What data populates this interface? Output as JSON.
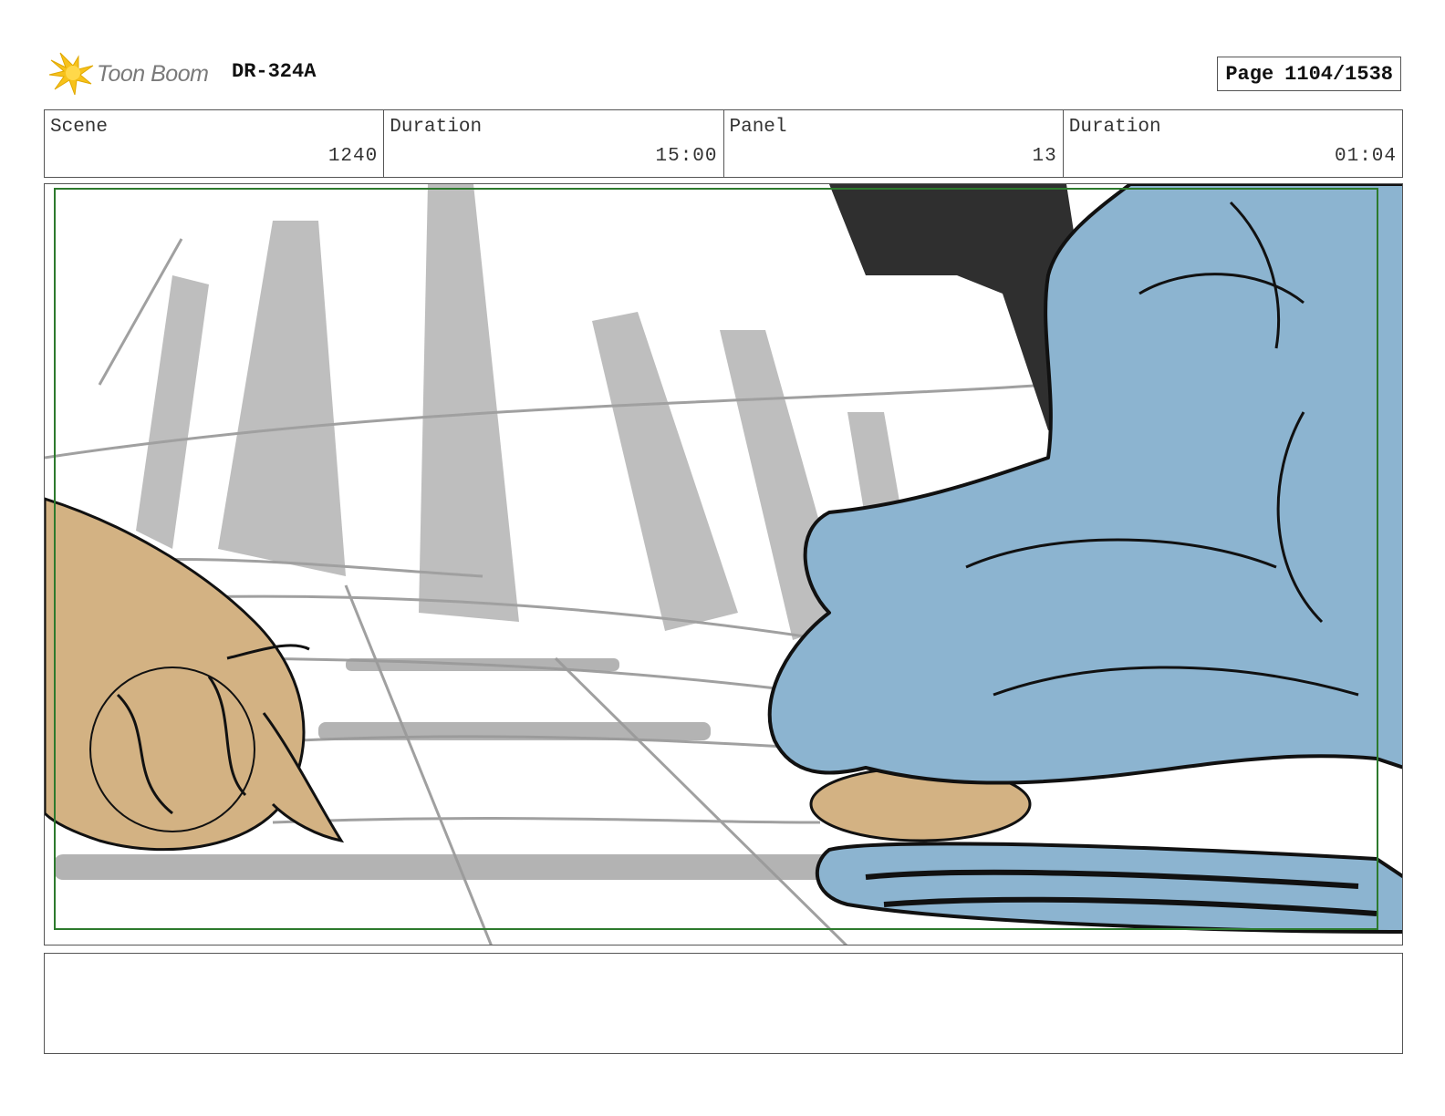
{
  "header": {
    "logo_text": "Toon Boom",
    "code": "DR-324A",
    "page_label": "Page",
    "page_value": "1104/1538"
  },
  "info": [
    {
      "label": "Scene",
      "value": "1240"
    },
    {
      "label": "Duration",
      "value": "15:00"
    },
    {
      "label": "Panel",
      "value": "13"
    },
    {
      "label": "Duration",
      "value": "01:04"
    }
  ],
  "colors": {
    "logo_yellow": "#f7c21b",
    "frame_green": "#2d7a2d",
    "character_blue": "#8cb4d0",
    "character_tan": "#d3b283",
    "sketch_gray": "#a9a9a9",
    "ink": "#111111"
  },
  "notes": ""
}
